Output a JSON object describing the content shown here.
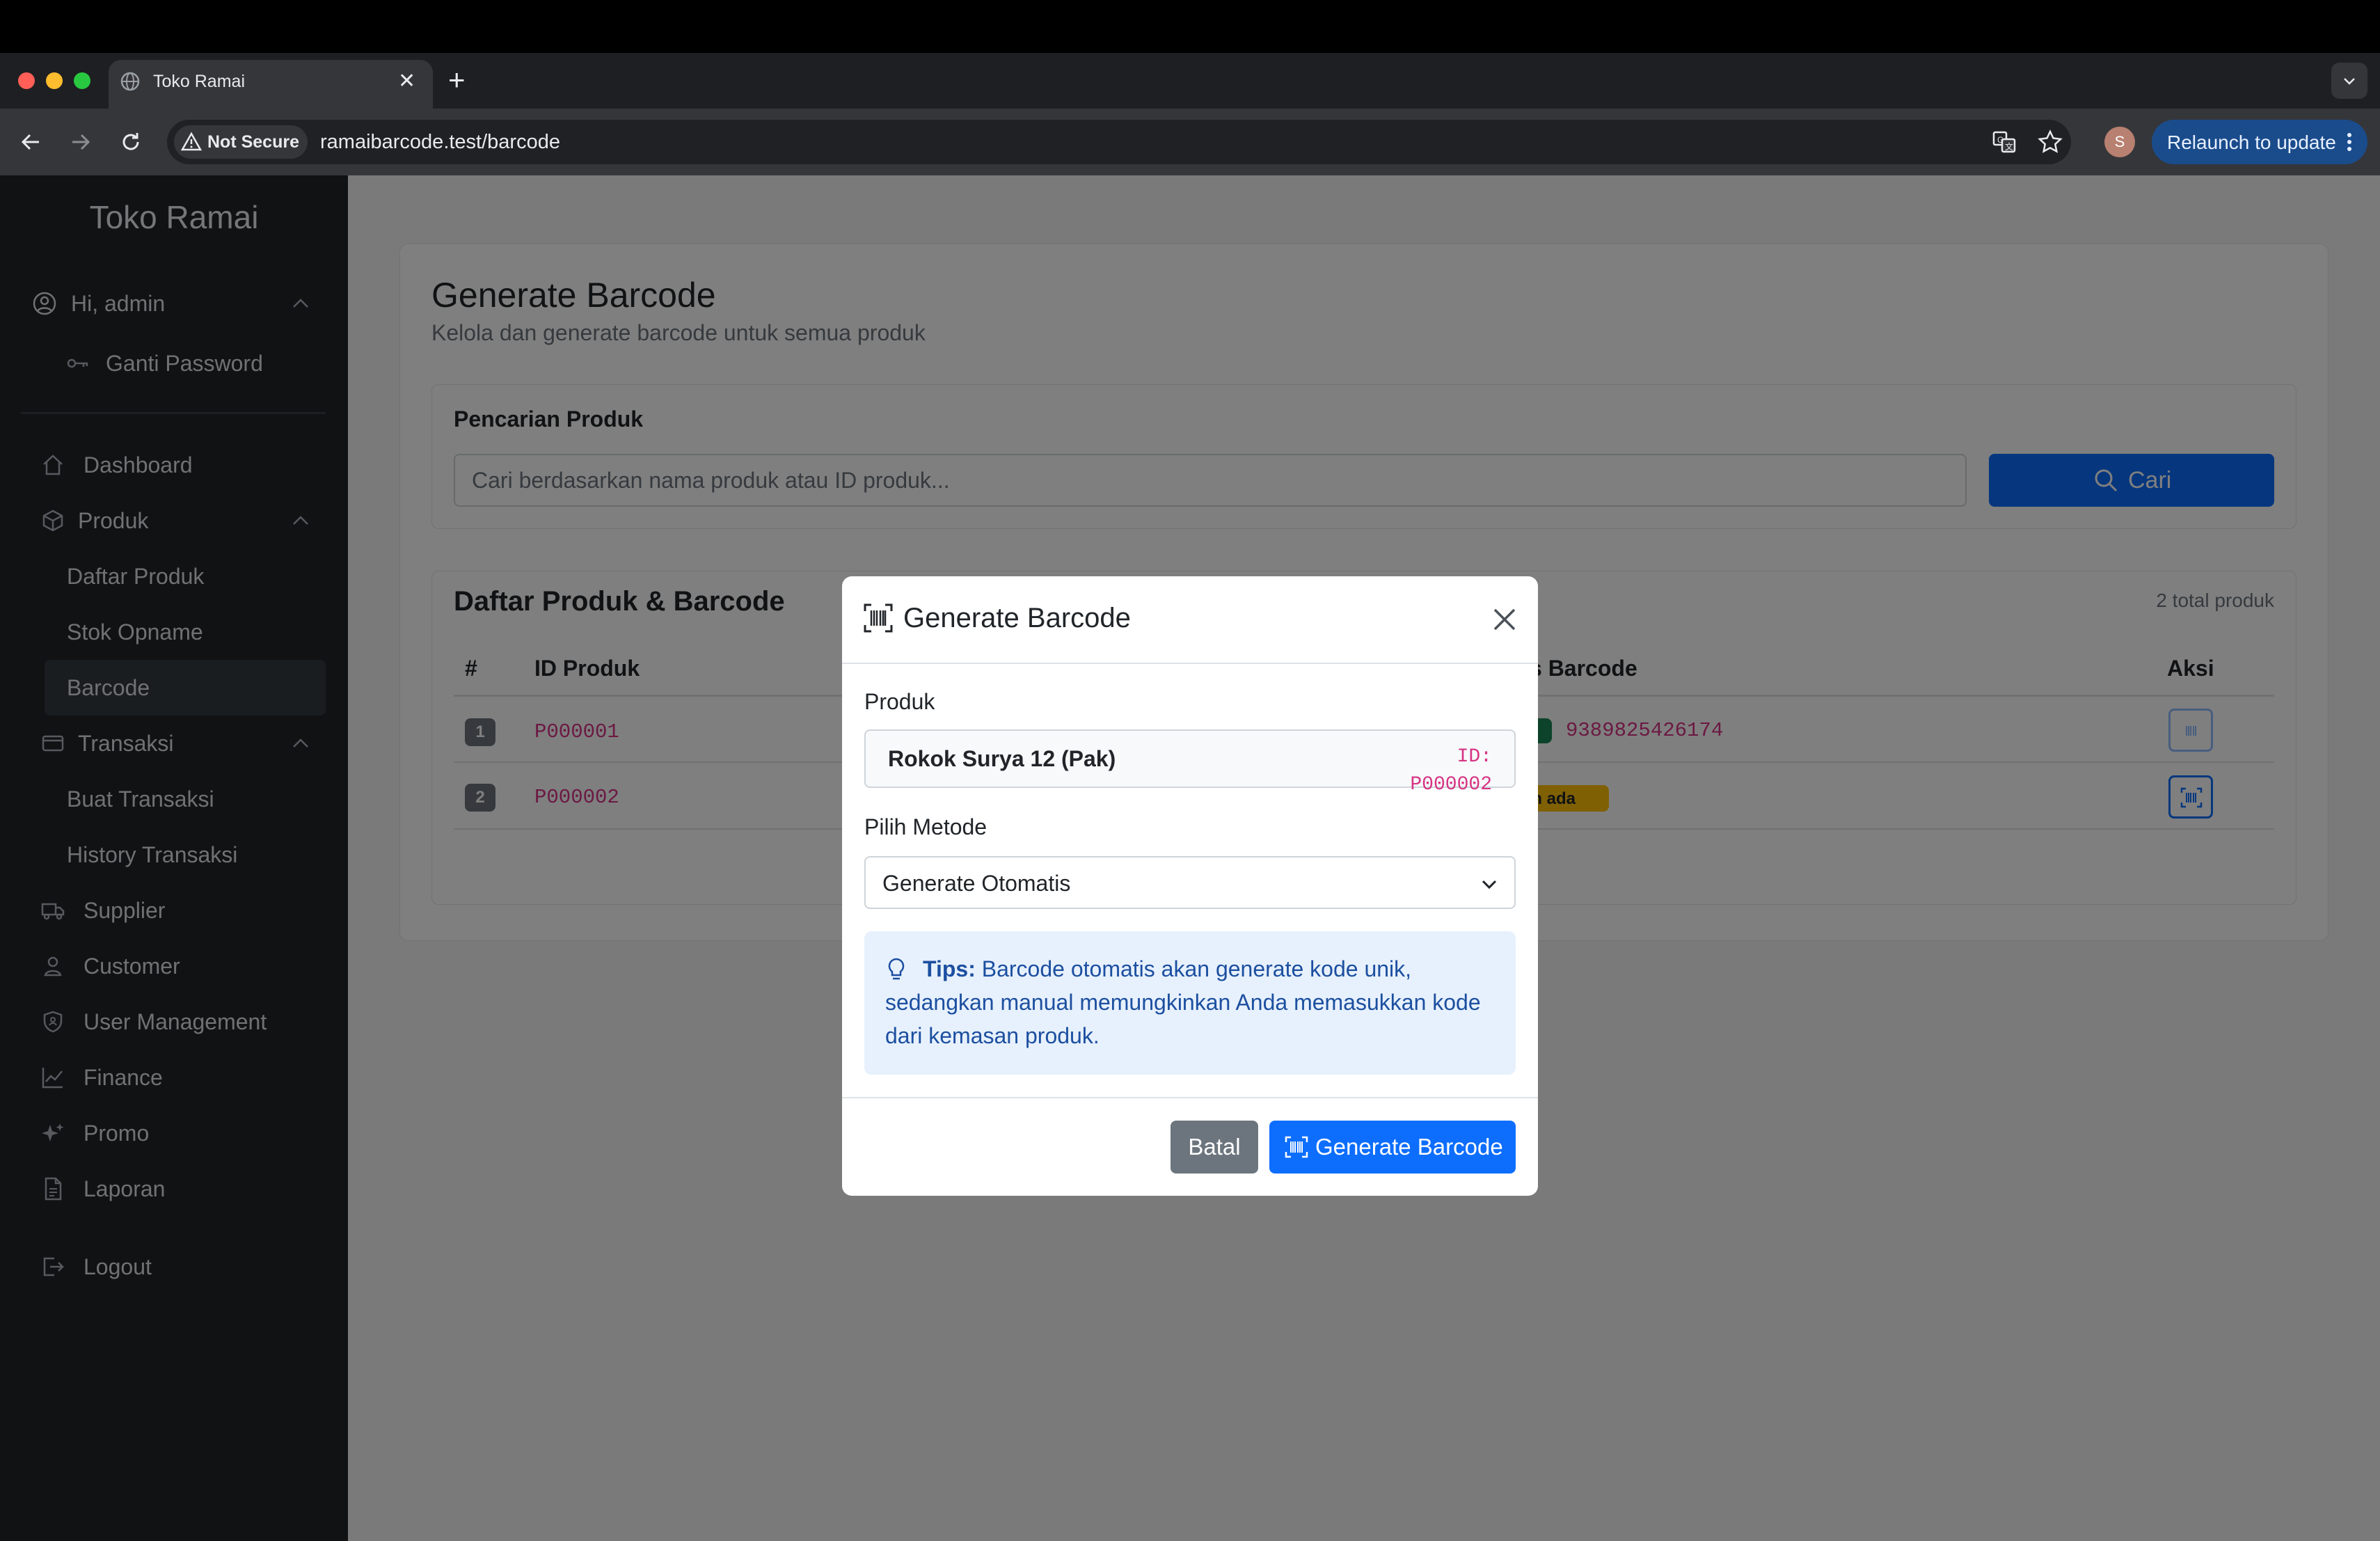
{
  "browser": {
    "tab_title": "Toko Ramai",
    "security_label": "Not Secure",
    "url": "ramaibarcode.test/barcode",
    "profile_initial": "S",
    "relaunch_label": "Relaunch to update",
    "traffic_colors": [
      "#ff5f57",
      "#febc2e",
      "#28c840"
    ]
  },
  "sidebar": {
    "brand": "Toko Ramai",
    "user_greeting": "Hi, admin",
    "change_password": "Ganti Password",
    "menu": {
      "dashboard": "Dashboard",
      "produk": "Produk",
      "daftar_produk": "Daftar Produk",
      "stok_opname": "Stok Opname",
      "barcode": "Barcode",
      "transaksi": "Transaksi",
      "buat_transaksi": "Buat Transaksi",
      "history_transaksi": "History Transaksi",
      "supplier": "Supplier",
      "customer": "Customer",
      "user_management": "User Management",
      "finance": "Finance",
      "promo": "Promo",
      "laporan": "Laporan",
      "logout": "Logout"
    }
  },
  "page": {
    "title": "Generate Barcode",
    "subtitle": "Kelola dan generate barcode untuk semua produk",
    "search": {
      "title": "Pencarian Produk",
      "placeholder": "Cari berdasarkan nama produk atau ID produk...",
      "button": "Cari"
    },
    "list": {
      "title": "Daftar Produk & Barcode",
      "count": "2 total produk",
      "headers": {
        "num": "#",
        "id": "ID Produk",
        "status": "s Barcode",
        "action": "Aksi"
      },
      "rows": [
        {
          "num": "1",
          "id": "P000001",
          "barcode": "9389825426174"
        },
        {
          "num": "2",
          "id": "P000002",
          "status": "um ada"
        }
      ]
    }
  },
  "modal": {
    "title": "Generate Barcode",
    "product_label": "Produk",
    "product_name": "Rokok Surya 12 (Pak)",
    "product_id": "ID: P000002",
    "method_label": "Pilih Metode",
    "method_value": "Generate Otomatis",
    "tips_title": "Tips:",
    "tips_text": "Barcode otomatis akan generate kode unik, sedangkan manual memungkinkan Anda memasukkan kode dari kemasan produk.",
    "cancel_label": "Batal",
    "submit_label": "Generate Barcode"
  },
  "colors": {
    "primary": "#0d6efd",
    "sidebar_bg": "#212529",
    "code_pink": "#d63384",
    "warning": "#ffc107",
    "success": "#198754"
  }
}
